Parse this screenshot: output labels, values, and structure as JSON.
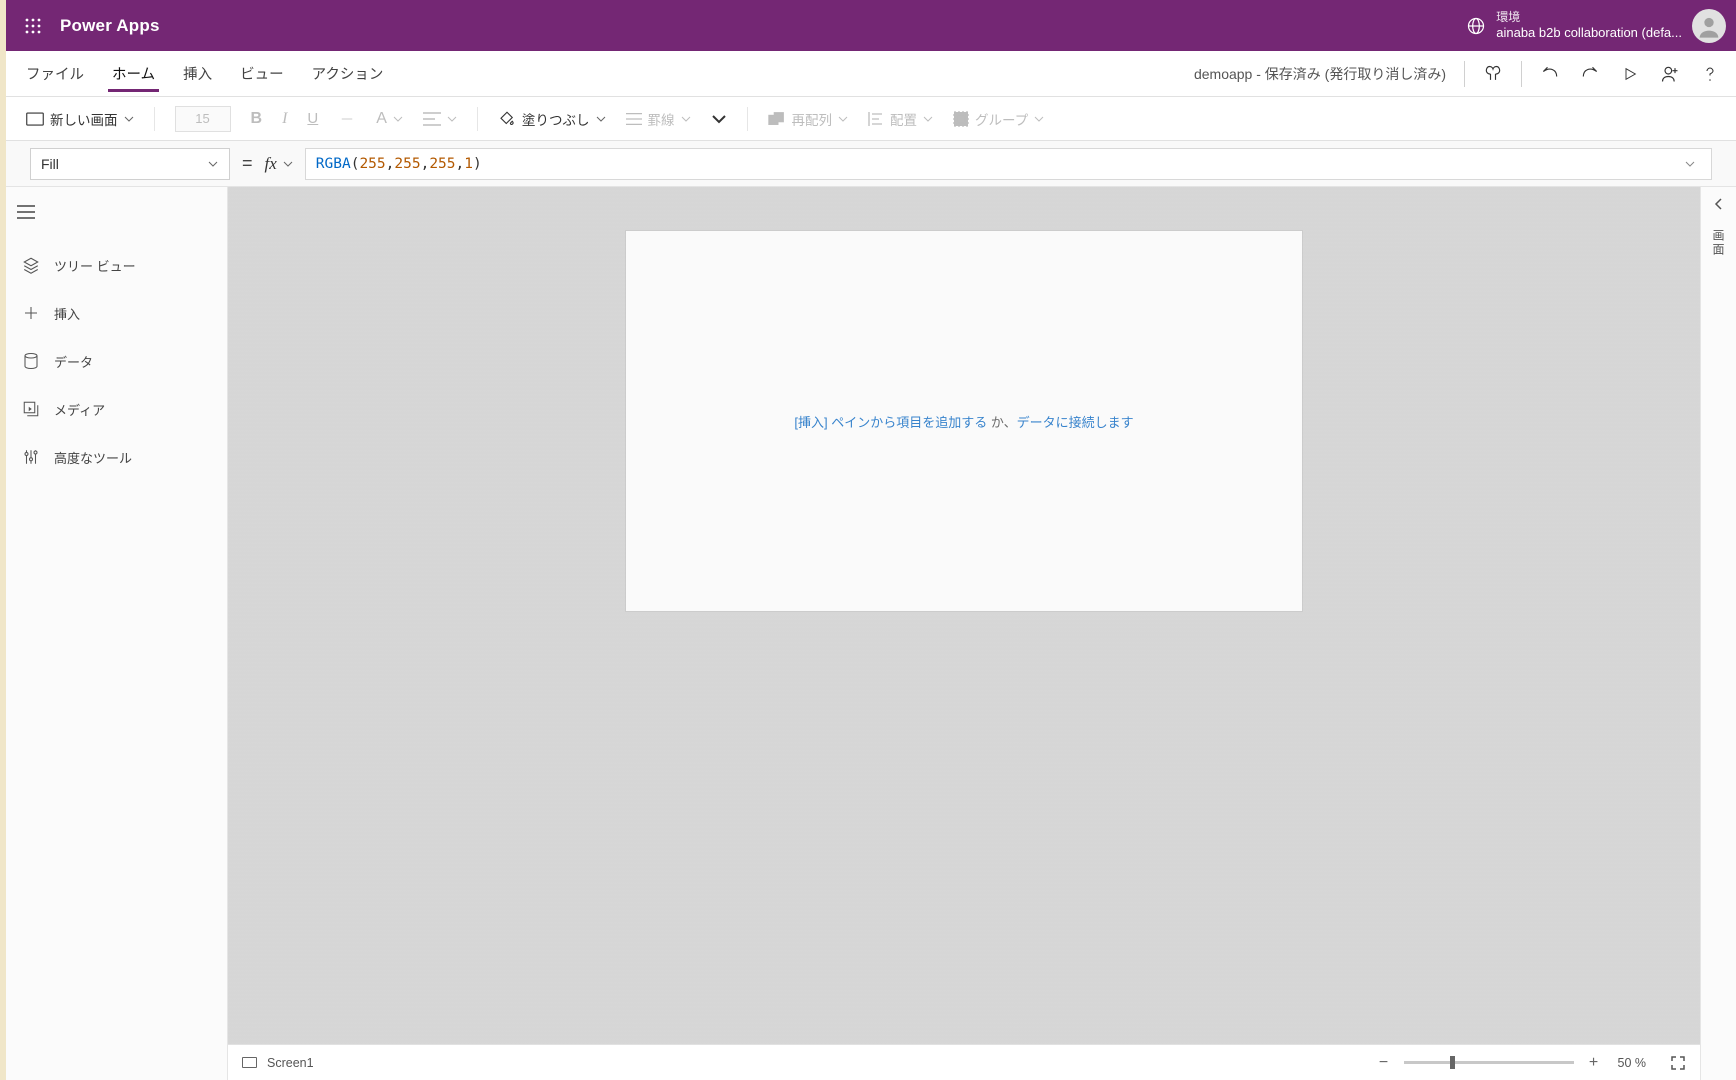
{
  "titlebar": {
    "app_name": "Power Apps",
    "env_label": "環境",
    "env_name": "ainaba b2b collaboration (defa..."
  },
  "menubar": {
    "file": "ファイル",
    "home": "ホーム",
    "insert": "挿入",
    "view": "ビュー",
    "action": "アクション",
    "status": "demoapp - 保存済み (発行取り消し済み)"
  },
  "ribbon": {
    "new_screen": "新しい画面",
    "font_size": "15",
    "fill_label": "塗りつぶし",
    "border_label": "罫線",
    "reorder_label": "再配列",
    "align_label": "配置",
    "group_label": "グループ"
  },
  "formula": {
    "property": "Fill",
    "fx": "fx",
    "fn": "RGBA",
    "args": [
      "255",
      "255",
      "255",
      "1"
    ]
  },
  "leftnav": {
    "tree": "ツリー ビュー",
    "insert": "挿入",
    "data": "データ",
    "media": "メディア",
    "advanced": "高度なツール"
  },
  "canvas": {
    "hint_link1": "[挿入] ペインから項目を追加する",
    "hint_mid": " か、",
    "hint_link2": "データに接続します"
  },
  "footer": {
    "screen": "Screen1",
    "zoom_pct": "50 %"
  },
  "rightrail": {
    "label": "画面"
  }
}
